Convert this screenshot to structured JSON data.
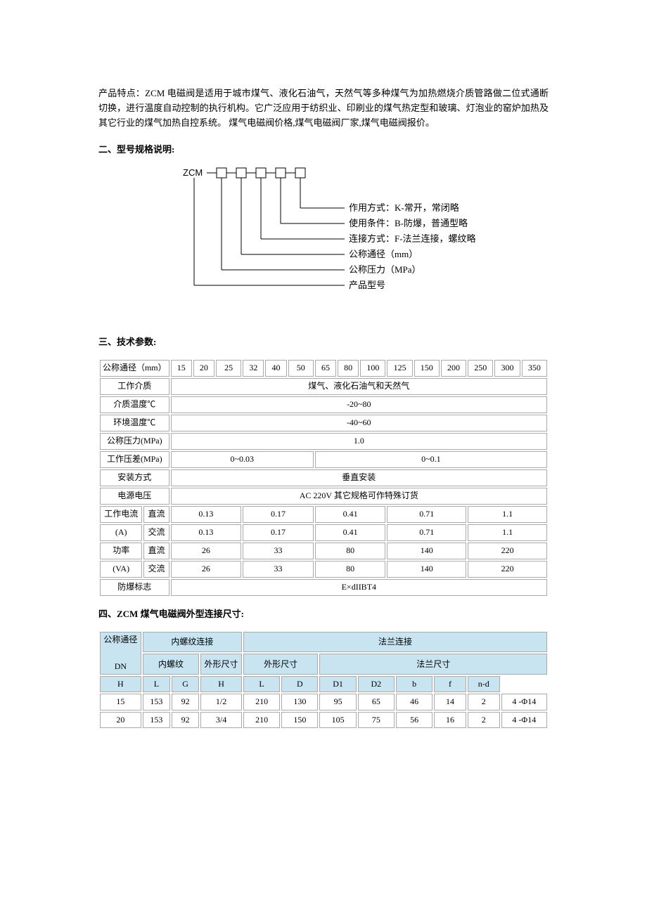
{
  "intro": {
    "text": "产品特点：ZCM 电磁阀是适用于城市煤气、液化石油气，天然气等多种煤气为加热燃烧介质管路做二位式通断切换，进行温度自动控制的执行机构。它广泛应用于纺织业、印刷业的煤气热定型和玻璃、灯泡业的窑炉加热及其它行业的煤气加热自控系统。 ",
    "link1": "煤气电磁阀价格",
    "sep1": ",",
    "link2": "煤气电磁阀厂家",
    "sep2": ",",
    "link3": "煤气电磁阀报价",
    "tail": "。"
  },
  "sec2_title": "二、型号规格说明:",
  "diagram": {
    "prefix": "ZCM",
    "lines": [
      "作用方式：K-常开，常闭略",
      "使用条件：B-防爆，普通型略",
      "连接方式：F-法兰连接，螺纹略",
      "公称通径（mm）",
      "公称压力（MPa）",
      "产品型号"
    ]
  },
  "sec3_title": "三、技术参数:",
  "params": {
    "r1_label": "公称通径（mm）",
    "r1_vals": [
      "15",
      "20",
      "25",
      "32",
      "40",
      "50",
      "65",
      "80",
      "100",
      "125",
      "150",
      "200",
      "250",
      "300",
      "350"
    ],
    "r2_label": "工作介质",
    "r2_val": "煤气、液化石油气和天然气",
    "r3_label": "介质温度℃",
    "r3_val": "-20~80",
    "r4_label": "环境温度℃",
    "r4_val": "-40~60",
    "r5_label": "公称压力(MPa)",
    "r5_val": "1.0",
    "r6_label": "工作压差(MPa)",
    "r6_v1": "0~0.03",
    "r6_v2": "0~0.1",
    "r7_label": "安装方式",
    "r7_val": "垂直安装",
    "r8_label": "电源电压",
    "r8_val": "AC 220V 其它规格可作特殊订货",
    "r9_label": "工作电流",
    "r9_sub1": "直流",
    "r9_sub1_unit": "(A)",
    "r9_sub2": "交流",
    "r9_dc": [
      "0.13",
      "0.17",
      "0.41",
      "0.71",
      "1.1"
    ],
    "r9_ac": [
      "0.13",
      "0.17",
      "0.41",
      "0.71",
      "1.1"
    ],
    "r10_label": "功率",
    "r10_sub1": "直流",
    "r10_unit": "(VA)",
    "r10_sub2": "交流",
    "r10_dc": [
      "26",
      "33",
      "80",
      "140",
      "220"
    ],
    "r10_ac": [
      "26",
      "33",
      "80",
      "140",
      "220"
    ],
    "r11_label": "防爆标志",
    "r11_val": "E×dIIBT4"
  },
  "sec4_title": "四、ZCM 煤气电磁阀外型连接尺寸:",
  "dims": {
    "h1": "公称通径",
    "h1b": "DN",
    "h2": "内螺纹连接",
    "h3": "法兰连接",
    "h2a": "内螺纹",
    "h2b": "外形尺寸",
    "h3a": "外形尺寸",
    "h3b": "法兰尺寸",
    "cols": [
      "H",
      "L",
      "G",
      "H",
      "L",
      "D",
      "D1",
      "D2",
      "b",
      "f",
      "n-d"
    ],
    "rows": [
      [
        "15",
        "153",
        "92",
        "1/2",
        "210",
        "130",
        "95",
        "65",
        "46",
        "14",
        "2",
        "4 -Φ14"
      ],
      [
        "20",
        "153",
        "92",
        "3/4",
        "210",
        "150",
        "105",
        "75",
        "56",
        "16",
        "2",
        "4 -Φ14"
      ]
    ]
  }
}
